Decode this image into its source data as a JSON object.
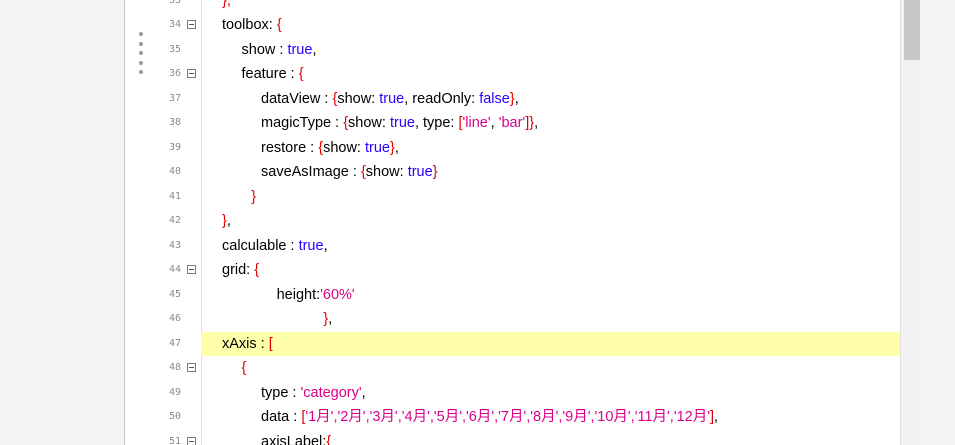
{
  "editor": {
    "lines": [
      {
        "no": "33",
        "fold": false,
        "indent": 0,
        "active": false,
        "tokens": [
          {
            "t": "},",
            "c": "p"
          }
        ]
      },
      {
        "no": "34",
        "fold": true,
        "indent": 0,
        "active": false,
        "tokens": [
          {
            "t": "toolbox: ",
            "c": ""
          },
          {
            "t": "{",
            "c": "p"
          }
        ]
      },
      {
        "no": "35",
        "fold": false,
        "indent": 1,
        "active": false,
        "tokens": [
          {
            "t": "show : ",
            "c": ""
          },
          {
            "t": "true",
            "c": "kw"
          },
          {
            "t": ",",
            "c": ""
          }
        ]
      },
      {
        "no": "36",
        "fold": true,
        "indent": 1,
        "active": false,
        "tokens": [
          {
            "t": "feature : ",
            "c": ""
          },
          {
            "t": "{",
            "c": "p"
          }
        ]
      },
      {
        "no": "37",
        "fold": false,
        "indent": 2,
        "active": false,
        "tokens": [
          {
            "t": "dataView : ",
            "c": ""
          },
          {
            "t": "{",
            "c": "p"
          },
          {
            "t": "show: ",
            "c": ""
          },
          {
            "t": "true",
            "c": "kw"
          },
          {
            "t": ", readOnly: ",
            "c": ""
          },
          {
            "t": "false",
            "c": "kw"
          },
          {
            "t": "}",
            "c": "p"
          },
          {
            "t": ",",
            "c": ""
          }
        ]
      },
      {
        "no": "38",
        "fold": false,
        "indent": 2,
        "active": false,
        "tokens": [
          {
            "t": "magicType : ",
            "c": ""
          },
          {
            "t": "{",
            "c": "p"
          },
          {
            "t": "show: ",
            "c": ""
          },
          {
            "t": "true",
            "c": "kw"
          },
          {
            "t": ", type: ",
            "c": ""
          },
          {
            "t": "[",
            "c": "p"
          },
          {
            "t": "'line'",
            "c": "str"
          },
          {
            "t": ", ",
            "c": ""
          },
          {
            "t": "'bar'",
            "c": "str"
          },
          {
            "t": "]",
            "c": "p"
          },
          {
            "t": "}",
            "c": "p"
          },
          {
            "t": ",",
            "c": ""
          }
        ]
      },
      {
        "no": "39",
        "fold": false,
        "indent": 2,
        "active": false,
        "tokens": [
          {
            "t": "restore : ",
            "c": ""
          },
          {
            "t": "{",
            "c": "p"
          },
          {
            "t": "show: ",
            "c": ""
          },
          {
            "t": "true",
            "c": "kw"
          },
          {
            "t": "}",
            "c": "p"
          },
          {
            "t": ",",
            "c": ""
          }
        ]
      },
      {
        "no": "40",
        "fold": false,
        "indent": 2,
        "active": false,
        "tokens": [
          {
            "t": "saveAsImage : ",
            "c": ""
          },
          {
            "t": "{",
            "c": "p"
          },
          {
            "t": "show: ",
            "c": ""
          },
          {
            "t": "true",
            "c": "kw"
          },
          {
            "t": "}",
            "c": "p"
          }
        ]
      },
      {
        "no": "41",
        "fold": false,
        "indent": 1.5,
        "active": false,
        "tokens": [
          {
            "t": "}",
            "c": "p"
          }
        ]
      },
      {
        "no": "42",
        "fold": false,
        "indent": 0,
        "active": false,
        "tokens": [
          {
            "t": "}",
            "c": "p"
          },
          {
            "t": ",",
            "c": ""
          }
        ]
      },
      {
        "no": "43",
        "fold": false,
        "indent": 0,
        "active": false,
        "tokens": [
          {
            "t": "calculable : ",
            "c": ""
          },
          {
            "t": "true",
            "c": "kw"
          },
          {
            "t": ",",
            "c": ""
          }
        ]
      },
      {
        "no": "44",
        "fold": true,
        "indent": 0,
        "active": false,
        "tokens": [
          {
            "t": "grid: ",
            "c": ""
          },
          {
            "t": "{",
            "c": "p"
          }
        ]
      },
      {
        "no": "45",
        "fold": false,
        "indent": 2.8,
        "active": false,
        "tokens": [
          {
            "t": "height:",
            "c": ""
          },
          {
            "t": "'60%'",
            "c": "str"
          }
        ]
      },
      {
        "no": "46",
        "fold": false,
        "indent": 5.2,
        "active": false,
        "tokens": [
          {
            "t": "}",
            "c": "p"
          },
          {
            "t": ",",
            "c": ""
          }
        ]
      },
      {
        "no": "47",
        "fold": false,
        "indent": 0,
        "active": true,
        "tokens": [
          {
            "t": "xAxis : ",
            "c": ""
          },
          {
            "t": "[",
            "c": "p"
          }
        ]
      },
      {
        "no": "48",
        "fold": true,
        "indent": 1,
        "active": false,
        "tokens": [
          {
            "t": "{",
            "c": "p"
          }
        ]
      },
      {
        "no": "49",
        "fold": false,
        "indent": 2,
        "active": false,
        "tokens": [
          {
            "t": "type : ",
            "c": ""
          },
          {
            "t": "'category'",
            "c": "str"
          },
          {
            "t": ",",
            "c": ""
          }
        ]
      },
      {
        "no": "50",
        "fold": false,
        "indent": 2,
        "active": false,
        "tokens": [
          {
            "t": "data : ",
            "c": ""
          },
          {
            "t": "[",
            "c": "p"
          },
          {
            "t": "'1月','2月','3月','4月','5月','6月','7月','8月','9月','10月','11月','12月'",
            "c": "str"
          },
          {
            "t": "]",
            "c": "p"
          },
          {
            "t": ",",
            "c": ""
          }
        ]
      },
      {
        "no": "51",
        "fold": true,
        "indent": 2,
        "active": false,
        "tokens": [
          {
            "t": "axisLabel:",
            "c": ""
          },
          {
            "t": "{",
            "c": "p"
          }
        ]
      }
    ]
  }
}
